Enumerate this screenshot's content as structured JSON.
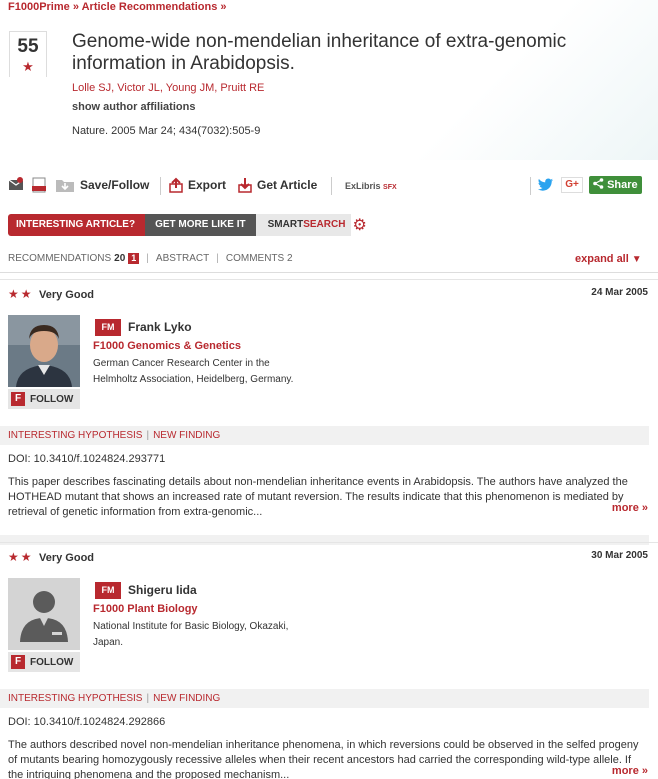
{
  "breadcrumb": {
    "root": "F1000Prime",
    "separator": "»",
    "section": "Article Recommendations",
    "trail": "»"
  },
  "article": {
    "score": "55",
    "title": "Genome-wide non-mendelian inheritance of extra-genomic information in Arabidopsis.",
    "authors": "Lolle SJ, Victor JL, Young JM, Pruitt RE",
    "affiliations_link": "show author affiliations",
    "citation": "Nature. 2005 Mar 24; 434(7032):505-9"
  },
  "toolbar": {
    "save_follow": "Save/Follow",
    "export": "Export",
    "get_article": "Get Article",
    "exlibris": "ExLibris",
    "sfx": "SFX",
    "gplus": "G+",
    "share": "Share"
  },
  "ribbon": {
    "interesting": "INTERESTING ARTICLE?",
    "get_more": "GET MORE LIKE IT",
    "smart": "SMART",
    "search": "SEARCH"
  },
  "tabs": {
    "recommendations": "RECOMMENDATIONS",
    "recommendations_count": "20",
    "recommendations_flag": "1",
    "abstract": "ABSTRACT",
    "comments": "COMMENTS 2",
    "separator": "|",
    "expand_all": "expand all"
  },
  "recommendations": [
    {
      "stars": "★★",
      "rating": "Very Good",
      "date": "24 Mar 2005",
      "badge": "FM",
      "member": "Frank Lyko",
      "faculty": "F1000 Genomics & Genetics",
      "institution": "German Cancer Research Center in the Helmholtz Association, Heidelberg, Germany.",
      "follow_icon": "F",
      "follow": "FOLLOW",
      "tag1": "INTERESTING HYPOTHESIS",
      "tag_sep": "|",
      "tag2": "NEW FINDING",
      "doi": "DOI: 10.3410/f.1024824.293771",
      "abstract": "This paper describes fascinating details about non-mendelian inheritance events in Arabidopsis. The authors have analyzed the HOTHEAD mutant that shows an increased rate of mutant reversion. The results indicate that this phenomenon is mediated by retrieval of genetic information from extra-genomic...",
      "more": "more »"
    },
    {
      "stars": "★★",
      "rating": "Very Good",
      "date": "30 Mar 2005",
      "badge": "FM",
      "member": "Shigeru Iida",
      "faculty": "F1000 Plant Biology",
      "institution": "National Institute for Basic Biology, Okazaki, Japan.",
      "follow_icon": "F",
      "follow": "FOLLOW",
      "tag1": "INTERESTING HYPOTHESIS",
      "tag_sep": "|",
      "tag2": "NEW FINDING",
      "doi": "DOI: 10.3410/f.1024824.292866",
      "abstract": "The authors described novel non-mendelian inheritance phenomena, in which reversions could be observed in the selfed progeny of mutants bearing homozygously recessive alleles when their recent ancestors had carried the corresponding wild-type allele. If the intriguing phenomena and the proposed mechanism...",
      "more": "more »"
    }
  ],
  "colors": {
    "accent": "#b8292f",
    "share_green": "#3f8f3a",
    "twitter": "#2aa3ef"
  }
}
